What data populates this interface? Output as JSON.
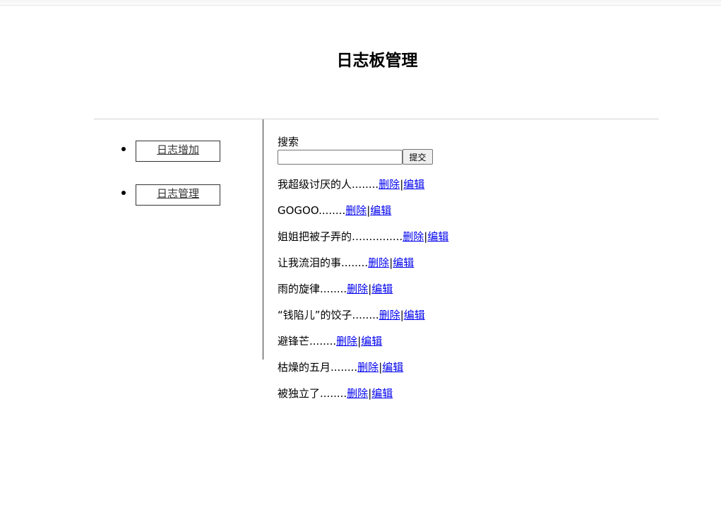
{
  "page": {
    "title": "日志板管理"
  },
  "nav": {
    "items": [
      {
        "label": "日志增加"
      },
      {
        "label": "日志管理"
      }
    ]
  },
  "search": {
    "label": "搜索",
    "value": "",
    "placeholder": "",
    "submit_label": "提交"
  },
  "logs": [
    {
      "title": "我超级讨厌的人",
      "dots": "........",
      "delete_label": "删除",
      "separator": "|",
      "edit_label": "编辑"
    },
    {
      "title": "GOGOO",
      "dots": "........",
      "delete_label": "删除",
      "separator": "|",
      "edit_label": "编辑"
    },
    {
      "title": "姐姐把被子弄的",
      "dots": "…............",
      "delete_label": "删除",
      "separator": "|",
      "edit_label": "编辑"
    },
    {
      "title": "让我流泪的事",
      "dots": "........",
      "delete_label": "删除",
      "separator": "|",
      "edit_label": "编辑"
    },
    {
      "title": "雨的旋律",
      "dots": "........",
      "delete_label": "删除",
      "separator": "|",
      "edit_label": "编辑"
    },
    {
      "title": "“钱陷儿”的饺子",
      "dots": "........",
      "delete_label": "删除",
      "separator": "|",
      "edit_label": "编辑"
    },
    {
      "title": "避锋芒",
      "dots": "........",
      "delete_label": "删除",
      "separator": "|",
      "edit_label": "编辑"
    },
    {
      "title": "枯燥的五月",
      "dots": "........",
      "delete_label": "删除",
      "separator": "|",
      "edit_label": "编辑"
    },
    {
      "title": "被独立了",
      "dots": "........",
      "delete_label": "删除",
      "separator": "|",
      "edit_label": "编辑"
    }
  ]
}
